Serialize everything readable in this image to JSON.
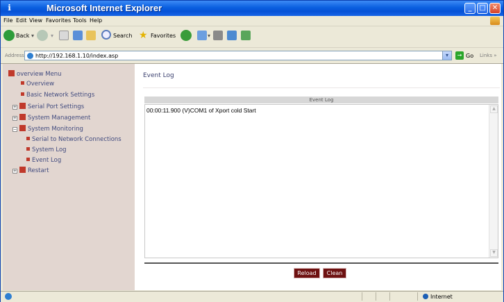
{
  "window": {
    "title": "Microsoft Internet Explorer"
  },
  "menu": [
    "File",
    "Edit",
    "View",
    "Favorites",
    "Tools",
    "Help"
  ],
  "toolbar": {
    "back": "Back",
    "search": "Search",
    "favorites": "Favorites"
  },
  "address": {
    "label": "Address",
    "url": "http://192.168.1.10/index.asp",
    "go": "Go",
    "links": "Links »"
  },
  "sidebar": {
    "root": "overview Menu",
    "items": [
      "Overview",
      "Basic Network Settings",
      "Serial Port Settings",
      "System Management",
      "System Monitoring",
      "Serial to Network Connections",
      "System Log",
      "Event Log",
      "Restart"
    ]
  },
  "main": {
    "heading": "Event Log",
    "panel_title": "Event Log",
    "log_text": "00:00:11.900 (V)COM1 of Xport cold Start",
    "reload": "Reload",
    "clean": "Clean"
  },
  "status": {
    "zone": "Internet"
  }
}
